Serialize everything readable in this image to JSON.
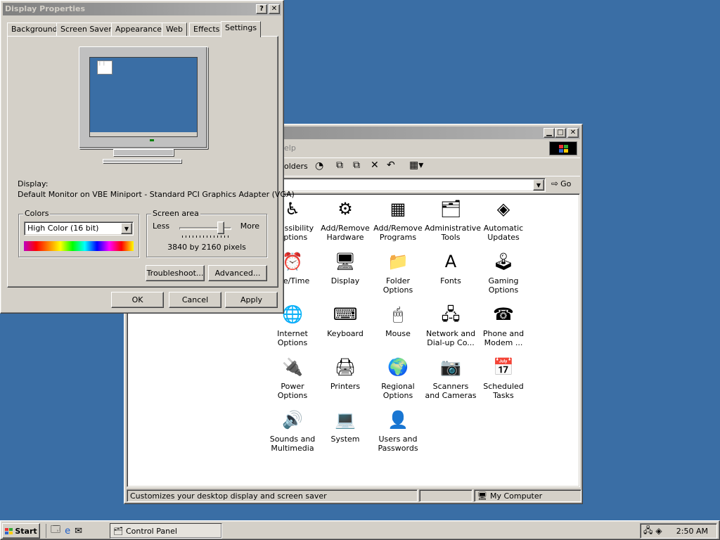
{
  "display_dialog": {
    "title": "Display Properties",
    "tabs": [
      "Background",
      "Screen Saver",
      "Appearance",
      "Web",
      "Effects",
      "Settings"
    ],
    "active_tab": "Settings",
    "display_label": "Display:",
    "display_value": "Default Monitor on VBE Miniport - Standard PCI Graphics Adapter (VGA)",
    "colors": {
      "group_label": "Colors",
      "selected": "High Color (16 bit)"
    },
    "screen_area": {
      "group_label": "Screen area",
      "less_label": "Less",
      "more_label": "More",
      "resolution_text": "3840 by 2160 pixels",
      "slider_level": 0.85
    },
    "troubleshoot_label": "Troubleshoot...",
    "advanced_label": "Advanced...",
    "ok_label": "OK",
    "cancel_label": "Cancel",
    "apply_label": "Apply"
  },
  "control_panel": {
    "menu_visible_text": "elp",
    "toolbar_folders_text": "olders",
    "go_label": "Go",
    "icons": [
      {
        "label": "ccessibility Options",
        "icon": "accessibility-icon",
        "glyph": "♿"
      },
      {
        "label": "Add/Remove Hardware",
        "icon": "hardware-icon",
        "glyph": "⚙"
      },
      {
        "label": "Add/Remove Programs",
        "icon": "programs-icon",
        "glyph": "▦"
      },
      {
        "label": "Administrative Tools",
        "icon": "admin-tools-icon",
        "glyph": "🗂"
      },
      {
        "label": "Automatic Updates",
        "icon": "updates-icon",
        "glyph": "◈"
      },
      {
        "label": "ate/Time",
        "icon": "date-time-icon",
        "glyph": "⏰"
      },
      {
        "label": "Display",
        "icon": "display-icon",
        "glyph": "🖥"
      },
      {
        "label": "Folder Options",
        "icon": "folder-options-icon",
        "glyph": "📁"
      },
      {
        "label": "Fonts",
        "icon": "fonts-icon",
        "glyph": "A"
      },
      {
        "label": "Gaming Options",
        "icon": "gaming-icon",
        "glyph": "🕹"
      },
      {
        "label": "Internet Options",
        "icon": "internet-icon",
        "glyph": "🌐"
      },
      {
        "label": "Keyboard",
        "icon": "keyboard-icon",
        "glyph": "⌨"
      },
      {
        "label": "Mouse",
        "icon": "mouse-icon",
        "glyph": "🖱"
      },
      {
        "label": "Network and Dial-up Co...",
        "icon": "network-icon",
        "glyph": "🖧"
      },
      {
        "label": "Phone and Modem ...",
        "icon": "phone-icon",
        "glyph": "☎"
      },
      {
        "label": "Power Options",
        "icon": "power-icon",
        "glyph": "🔌"
      },
      {
        "label": "Printers",
        "icon": "printers-icon",
        "glyph": "🖨"
      },
      {
        "label": "Regional Options",
        "icon": "regional-icon",
        "glyph": "🌍"
      },
      {
        "label": "Scanners and Cameras",
        "icon": "scanner-icon",
        "glyph": "📷"
      },
      {
        "label": "Scheduled Tasks",
        "icon": "scheduled-tasks-icon",
        "glyph": "📅"
      },
      {
        "label": "Sounds and Multimedia",
        "icon": "sounds-icon",
        "glyph": "🔊"
      },
      {
        "label": "System",
        "icon": "system-icon",
        "glyph": "💻"
      },
      {
        "label": "Users and Passwords",
        "icon": "users-icon",
        "glyph": "👤"
      }
    ],
    "status_text": "Customizes your desktop display and screen saver",
    "status_location": "My Computer"
  },
  "taskbar": {
    "start_label": "Start",
    "task_label": "Control Panel",
    "clock": "2:50 AM"
  },
  "colors": {
    "desktop": "#3a6ea5",
    "face": "#d4d0c8",
    "inactive_title": "#808080"
  }
}
